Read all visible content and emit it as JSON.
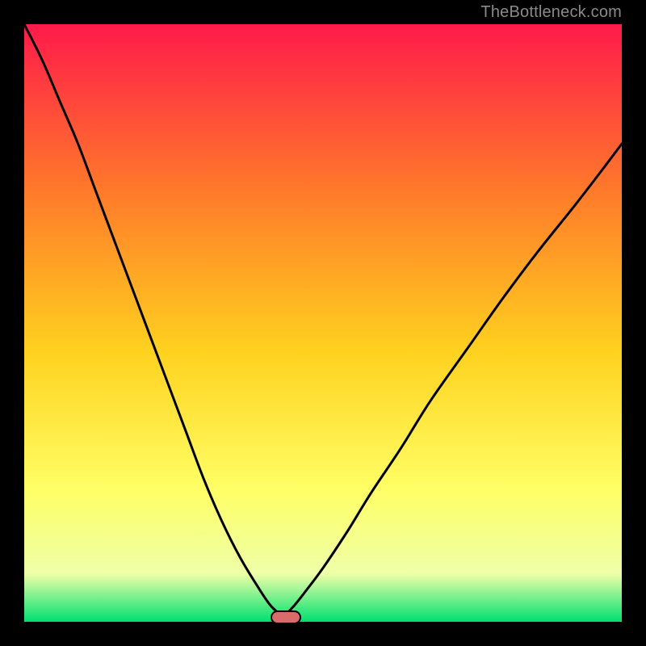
{
  "watermark": "TheBottleneck.com",
  "colors": {
    "frame": "#000000",
    "curve": "#000000",
    "marker_fill": "#d96b6b",
    "marker_border": "#000000",
    "grad_top": "#ff1a4a",
    "grad_mid1": "#ff7a2a",
    "grad_mid2": "#ffd21f",
    "grad_mid3": "#ffff66",
    "grad_mid4": "#eeffa8",
    "grad_bottom": "#00e070"
  },
  "chart_data": {
    "type": "line",
    "title": "",
    "xlabel": "",
    "ylabel": "",
    "xlim": [
      0,
      100
    ],
    "ylim": [
      0,
      100
    ],
    "note": "x and y are percent of the inner plot area (0,0 at top-left). Curve is the black V-shaped line; minimum near x≈43, y≈99. Marker sits at the curve minimum.",
    "series": [
      {
        "name": "bottleneck-curve-left",
        "x": [
          0,
          3,
          6,
          9,
          12,
          15,
          18,
          21,
          24,
          27,
          30,
          33,
          36,
          39,
          41,
          42.5,
          43.5
        ],
        "values": [
          0,
          6,
          13,
          20,
          28,
          36,
          44,
          52,
          60,
          68,
          76,
          83,
          89,
          94,
          97,
          98.5,
          99
        ]
      },
      {
        "name": "bottleneck-curve-right",
        "x": [
          43.5,
          45,
          47,
          50,
          54,
          58,
          63,
          68,
          74,
          80,
          86,
          92,
          97,
          100
        ],
        "values": [
          99,
          97.5,
          95,
          91,
          85,
          78.5,
          71,
          63,
          54.5,
          46,
          38,
          30.5,
          24,
          20
        ]
      }
    ],
    "marker": {
      "x": 43.5,
      "y": 99,
      "rx_pct": 2.3,
      "ry_pct": 0.9
    }
  }
}
